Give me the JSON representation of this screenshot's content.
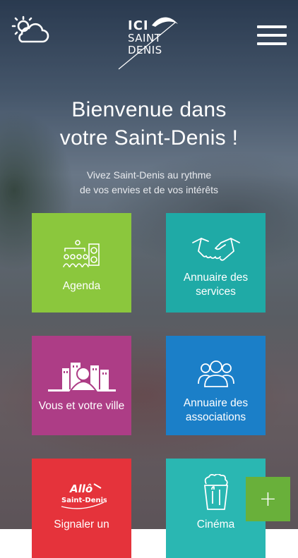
{
  "header": {
    "weather_icon": "partly-cloudy-icon",
    "logo": {
      "line1": "ICI",
      "line2": "SAINT",
      "line3": "DENIS"
    },
    "menu_icon": "hamburger-menu-icon"
  },
  "welcome": {
    "title_line1": "Bienvenue dans",
    "title_line2": "votre Saint-Denis !",
    "subtitle_line1": "Vivez Saint-Denis au rythme",
    "subtitle_line2": "de vos envies et de vos intérêts"
  },
  "tiles": [
    {
      "label": "Agenda",
      "icon": "agenda-event-icon",
      "color": "#8bc73d"
    },
    {
      "label": "Annuaire des services",
      "icon": "handshake-icon",
      "color": "#1faaa6"
    },
    {
      "label": "Vous et votre ville",
      "icon": "city-person-icon",
      "color": "#ad3d86"
    },
    {
      "label": "Annuaire des associations",
      "icon": "group-people-icon",
      "color": "#1b7fc8"
    },
    {
      "label": "Signaler un",
      "icon": "allo-saint-denis-icon",
      "icon_text_1": "Allô",
      "icon_text_2": "Saint-Denis",
      "color": "#e5333b"
    },
    {
      "label": "Cinéma",
      "icon": "popcorn-icon",
      "color": "#2ab7b2"
    }
  ],
  "fab": {
    "label": "+",
    "color": "#69b03a"
  }
}
